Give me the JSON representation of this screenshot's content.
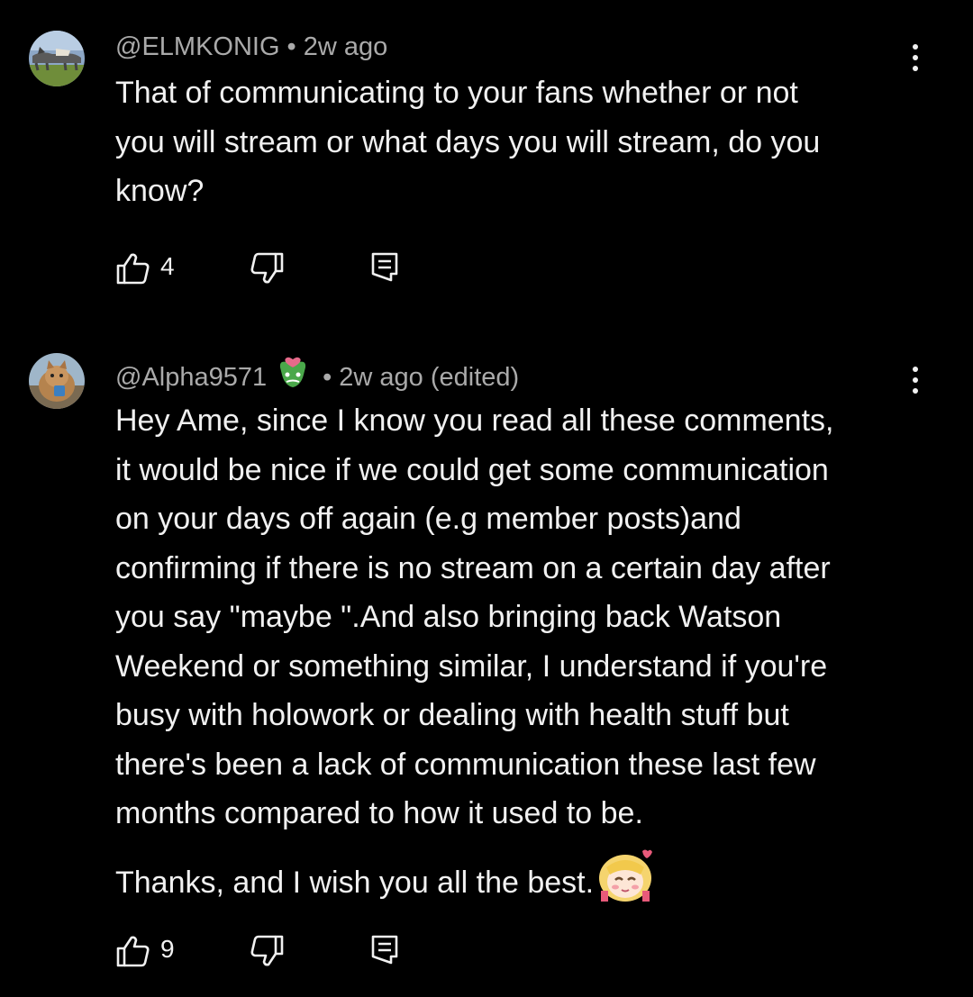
{
  "comments": [
    {
      "handle": "@ELMKONIG",
      "separator": "•",
      "time": "2w ago",
      "lines": [
        "That of communicating to your fans whether or not",
        "you will stream or what days you will stream, do you",
        "know?"
      ],
      "likes": "4",
      "avatar_icon": "horse-photo-avatar"
    },
    {
      "handle": "@Alpha9571",
      "separator": "•",
      "time": "2w ago (edited)",
      "lines": [
        "Hey Ame, since I know you read all these comments,",
        "it would be nice if we could get some communication",
        "on your days off again (e.g member posts)and",
        "confirming if there is no stream on a certain day after",
        "you say \"maybe \".And also bringing back Watson",
        "Weekend or something similar, I understand if you're",
        "busy with holowork or dealing with health stuff but",
        "there's been a lack of communication these last few",
        "months compared to how it used to be."
      ],
      "closing": "Thanks, and I wish you all the best.",
      "likes": "9",
      "avatar_icon": "cat-photo-avatar",
      "badge_icon": "membership-emote-icon",
      "closing_icon": "blonde-girl-emote-icon"
    }
  ],
  "colors": {
    "background": "#000000",
    "text": "#f1f1f1",
    "meta": "#aaaaaa"
  }
}
